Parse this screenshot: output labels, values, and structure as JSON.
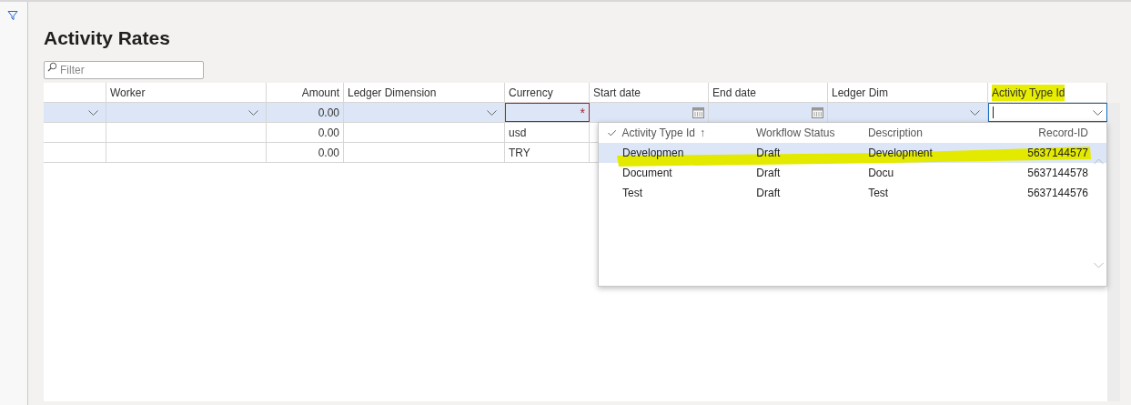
{
  "title": "Activity Rates",
  "filter": {
    "placeholder": "Filter"
  },
  "grid": {
    "columns": [
      {
        "kind": "text"
      },
      {
        "label": "Worker",
        "kind": "text"
      },
      {
        "label": "Amount",
        "kind": "number"
      },
      {
        "label": "Ledger Dimension",
        "kind": "text"
      },
      {
        "label": "Currency",
        "kind": "text"
      },
      {
        "label": "Start date",
        "kind": "text"
      },
      {
        "label": "End date",
        "kind": "text"
      },
      {
        "label": "Ledger Dim",
        "kind": "text"
      },
      {
        "label": "Activity Type Id",
        "kind": "text",
        "highlighted": true
      }
    ],
    "rows": [
      {
        "selected": true,
        "cells": [
          {
            "kind": "dropdown"
          },
          {
            "kind": "dropdown"
          },
          {
            "kind": "text",
            "value": "0.00"
          },
          {
            "kind": "dropdown"
          },
          {
            "kind": "required",
            "mark": "*"
          },
          {
            "kind": "date"
          },
          {
            "kind": "date"
          },
          {
            "kind": "dropdown"
          },
          {
            "kind": "input"
          }
        ]
      },
      {
        "selected": false,
        "cells": [
          {
            "kind": "text"
          },
          {
            "kind": "text"
          },
          {
            "kind": "text",
            "value": "0.00"
          },
          {
            "kind": "text"
          },
          {
            "kind": "text",
            "value": "usd"
          }
        ]
      },
      {
        "selected": false,
        "cells": [
          {
            "kind": "text"
          },
          {
            "kind": "text"
          },
          {
            "kind": "text",
            "value": "0.00"
          },
          {
            "kind": "text"
          },
          {
            "kind": "text",
            "value": "TRY"
          }
        ]
      }
    ]
  },
  "lookup": {
    "columns": [
      {
        "label": "Activity Type Id",
        "sort": "↑",
        "kind": "text"
      },
      {
        "label": "Workflow Status",
        "kind": "text"
      },
      {
        "label": "Description",
        "kind": "text"
      },
      {
        "label": "Record-ID",
        "kind": "number"
      }
    ],
    "rows": [
      {
        "selected": true,
        "highlighted": true,
        "cells": [
          "Developmen",
          "Draft",
          "Development",
          "5637144577"
        ]
      },
      {
        "selected": false,
        "highlighted": false,
        "cells": [
          "Document",
          "Draft",
          "Docu",
          "5637144578"
        ]
      },
      {
        "selected": false,
        "highlighted": false,
        "cells": [
          "Test",
          "Draft",
          "Test",
          "5637144576"
        ]
      }
    ]
  }
}
